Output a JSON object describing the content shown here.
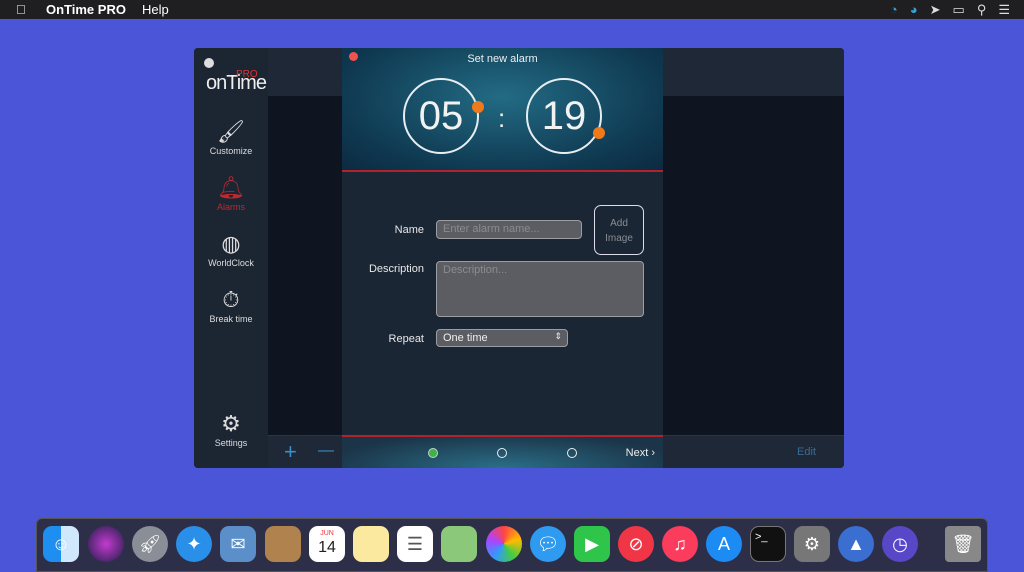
{
  "menubar": {
    "app_name": "OnTime PRO",
    "menus": [
      "Help"
    ],
    "status_icons": [
      "clock-icon",
      "speedometer-icon",
      "cursor-icon",
      "display-icon",
      "search-icon",
      "list-icon"
    ]
  },
  "sidebar": {
    "logo": "onTime",
    "logo_badge": "PRO",
    "items": [
      {
        "label": "Customize",
        "icon": "paintbrush-icon"
      },
      {
        "label": "Alarms",
        "icon": "bell-icon",
        "active": true
      },
      {
        "label": "WorldClock",
        "icon": "globe-icon"
      },
      {
        "label": "Break time",
        "icon": "stopwatch-icon"
      }
    ],
    "settings": "Settings"
  },
  "toolbar": {
    "add": "+",
    "remove": "—",
    "edit": "Edit"
  },
  "sheet": {
    "title": "Set new alarm",
    "hours": "05",
    "minutes": "19",
    "separator": ":",
    "name_label": "Name",
    "name_placeholder": "Enter alarm name...",
    "name_value": "",
    "add_image_line1": "Add",
    "add_image_line2": "Image",
    "description_label": "Description",
    "description_placeholder": "Description...",
    "repeat_label": "Repeat",
    "repeat_value": "One time",
    "next": "Next",
    "page_count": 3,
    "current_page": 1
  },
  "colors": {
    "accent_red": "#c0282d",
    "knob_orange": "#f07a1a",
    "page_dot_active": "#3db34a",
    "desktop": "#4a55d8"
  },
  "dock": {
    "calendar_month": "JUN",
    "calendar_day": "14",
    "apps": [
      "finder",
      "siri",
      "launchpad",
      "safari",
      "mail",
      "contacts",
      "calendar",
      "notes",
      "reminders",
      "maps",
      "photos",
      "messages",
      "facetime",
      "news",
      "music",
      "app-store",
      "terminal",
      "system-preferences",
      "altitude",
      "ontime",
      "trash"
    ]
  }
}
